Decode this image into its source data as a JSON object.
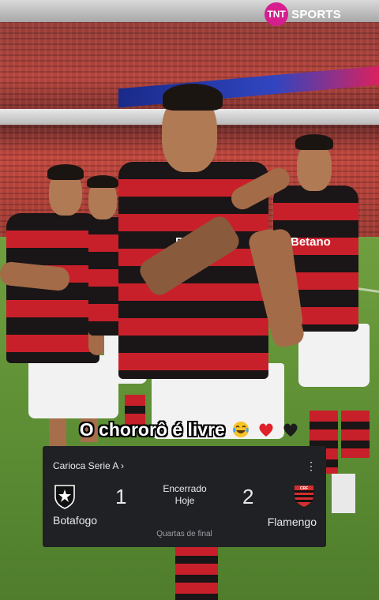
{
  "broadcaster": {
    "badge": "TNT",
    "name": "SPORTS"
  },
  "caption": {
    "text": "O chororô é livre",
    "emojis": [
      "tears-of-joy-emoji",
      "red-heart-emoji",
      "black-heart-emoji"
    ]
  },
  "jersey": {
    "sponsor": "Betano"
  },
  "match_card": {
    "league": "Carioca Serie A ›",
    "menu_icon": "more-vertical-icon",
    "home": {
      "name": "Botafogo",
      "score": "1"
    },
    "away": {
      "name": "Flamengo",
      "score": "2"
    },
    "status": "Encerrado",
    "date": "Hoje",
    "stage": "Quartas de final",
    "colors": {
      "background": "#202124",
      "text": "#e8eaed",
      "muted": "#9aa0a6",
      "flamengo_red": "#d32f2f"
    }
  }
}
